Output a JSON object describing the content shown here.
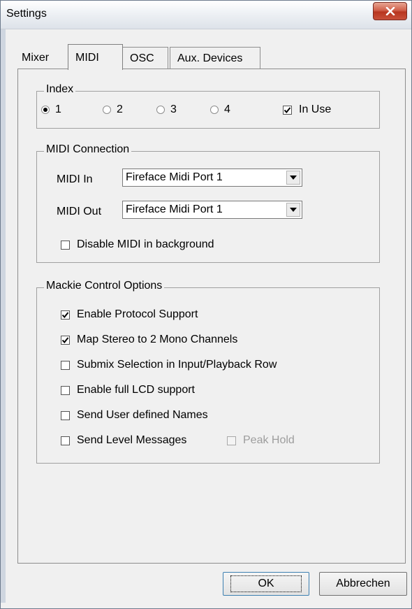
{
  "window": {
    "title": "Settings"
  },
  "tabs": [
    {
      "label": "Mixer"
    },
    {
      "label": "MIDI"
    },
    {
      "label": "OSC"
    },
    {
      "label": "Aux. Devices"
    }
  ],
  "index_group": {
    "legend": "Index",
    "radios": [
      {
        "label": "1",
        "selected": true
      },
      {
        "label": "2",
        "selected": false
      },
      {
        "label": "3",
        "selected": false
      },
      {
        "label": "4",
        "selected": false
      }
    ],
    "in_use": {
      "label": "In Use",
      "checked": true
    }
  },
  "midi_connection": {
    "legend": "MIDI Connection",
    "midi_in": {
      "label": "MIDI In",
      "value": "Fireface Midi Port 1"
    },
    "midi_out": {
      "label": "MIDI Out",
      "value": "Fireface Midi Port 1"
    },
    "disable_background": {
      "label": "Disable MIDI in background",
      "checked": false
    }
  },
  "mackie": {
    "legend": "Mackie Control Options",
    "options": [
      {
        "label": "Enable Protocol Support",
        "checked": true
      },
      {
        "label": "Map Stereo to 2 Mono Channels",
        "checked": true
      },
      {
        "label": "Submix Selection in Input/Playback Row",
        "checked": false
      },
      {
        "label": "Enable full LCD support",
        "checked": false
      },
      {
        "label": "Send User defined Names",
        "checked": false
      },
      {
        "label": "Send Level Messages",
        "checked": false
      }
    ],
    "peak_hold": {
      "label": "Peak Hold",
      "checked": false,
      "enabled": false
    }
  },
  "buttons": {
    "ok": "OK",
    "cancel": "Abbrechen"
  },
  "icons": {
    "close": "close-icon",
    "dropdown": "chevron-down-icon",
    "check": "check-icon"
  }
}
